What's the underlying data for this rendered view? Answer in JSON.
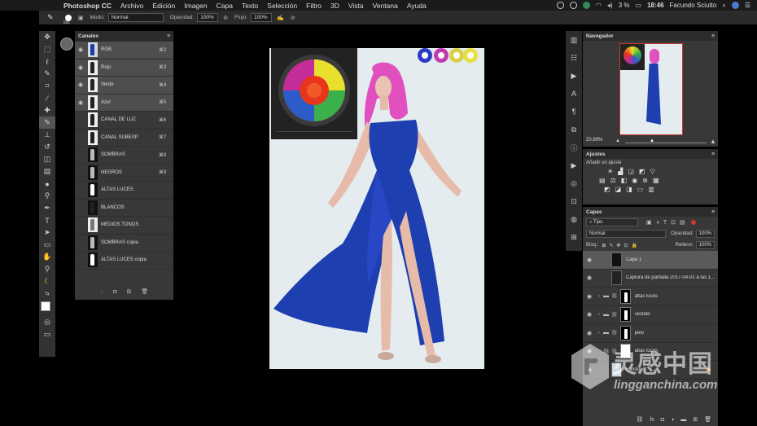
{
  "menubar": {
    "app": "Photoshop CC",
    "items": [
      "Archivo",
      "Edición",
      "Imagen",
      "Capa",
      "Texto",
      "Selección",
      "Filtro",
      "3D",
      "Vista",
      "Ventana",
      "Ayuda"
    ],
    "battery": "3 %",
    "time": "18:46",
    "user": "Facundo Sciutto"
  },
  "options": {
    "brush_size": "181",
    "mode_label": "Modo:",
    "mode_value": "Normal",
    "opacity_label": "Opacidad:",
    "opacity_value": "100%",
    "flow_label": "Flujo:",
    "flow_value": "100%"
  },
  "channels": {
    "title": "Canales",
    "rows": [
      {
        "name": "RGB",
        "key": "⌘2"
      },
      {
        "name": "Rojo",
        "key": "⌘3"
      },
      {
        "name": "Verde",
        "key": "⌘4"
      },
      {
        "name": "Azul",
        "key": "⌘5"
      },
      {
        "name": "CANAL DE LUZ",
        "key": "⌘6"
      },
      {
        "name": "CANAL SUBEXP",
        "key": "⌘7"
      },
      {
        "name": "SOMBRAS",
        "key": "⌘8"
      },
      {
        "name": "NEGROS",
        "key": "⌘9"
      },
      {
        "name": "ALTAS LUCES",
        "key": ""
      },
      {
        "name": "BLANCOS",
        "key": ""
      },
      {
        "name": "MEDIOS TONOS",
        "key": ""
      },
      {
        "name": "SOMBRAS copia",
        "key": ""
      },
      {
        "name": "ALTAS LUCES copia",
        "key": ""
      }
    ]
  },
  "navigator": {
    "title": "Navegador",
    "zoom": "20,99%"
  },
  "adjustments": {
    "title": "Ajustes",
    "subtitle": "Añadir un ajuste"
  },
  "layers": {
    "title": "Capas",
    "filter_kind": "Tipo",
    "blend_mode": "Normal",
    "opacity_label": "Opacidad:",
    "opacity_value": "100%",
    "lock_label": "Bloq.:",
    "fill_label": "Relleno:",
    "fill_value": "100%",
    "rows": [
      {
        "name": "Capa 1"
      },
      {
        "name": "Captura de pantalla 2017-04-01 a las 1..."
      },
      {
        "name": "altas luces"
      },
      {
        "name": "vestido"
      },
      {
        "name": "pelo"
      },
      {
        "name": "altas luces"
      },
      {
        "name": "Fondo"
      }
    ]
  },
  "watermark": {
    "cn": "灵感中国",
    "url": "lingganchina.com"
  },
  "colors": {
    "selection": "#5a5a5a",
    "panel": "#383838",
    "dress": "#1e3fb0",
    "hair": "#e24fbf"
  }
}
